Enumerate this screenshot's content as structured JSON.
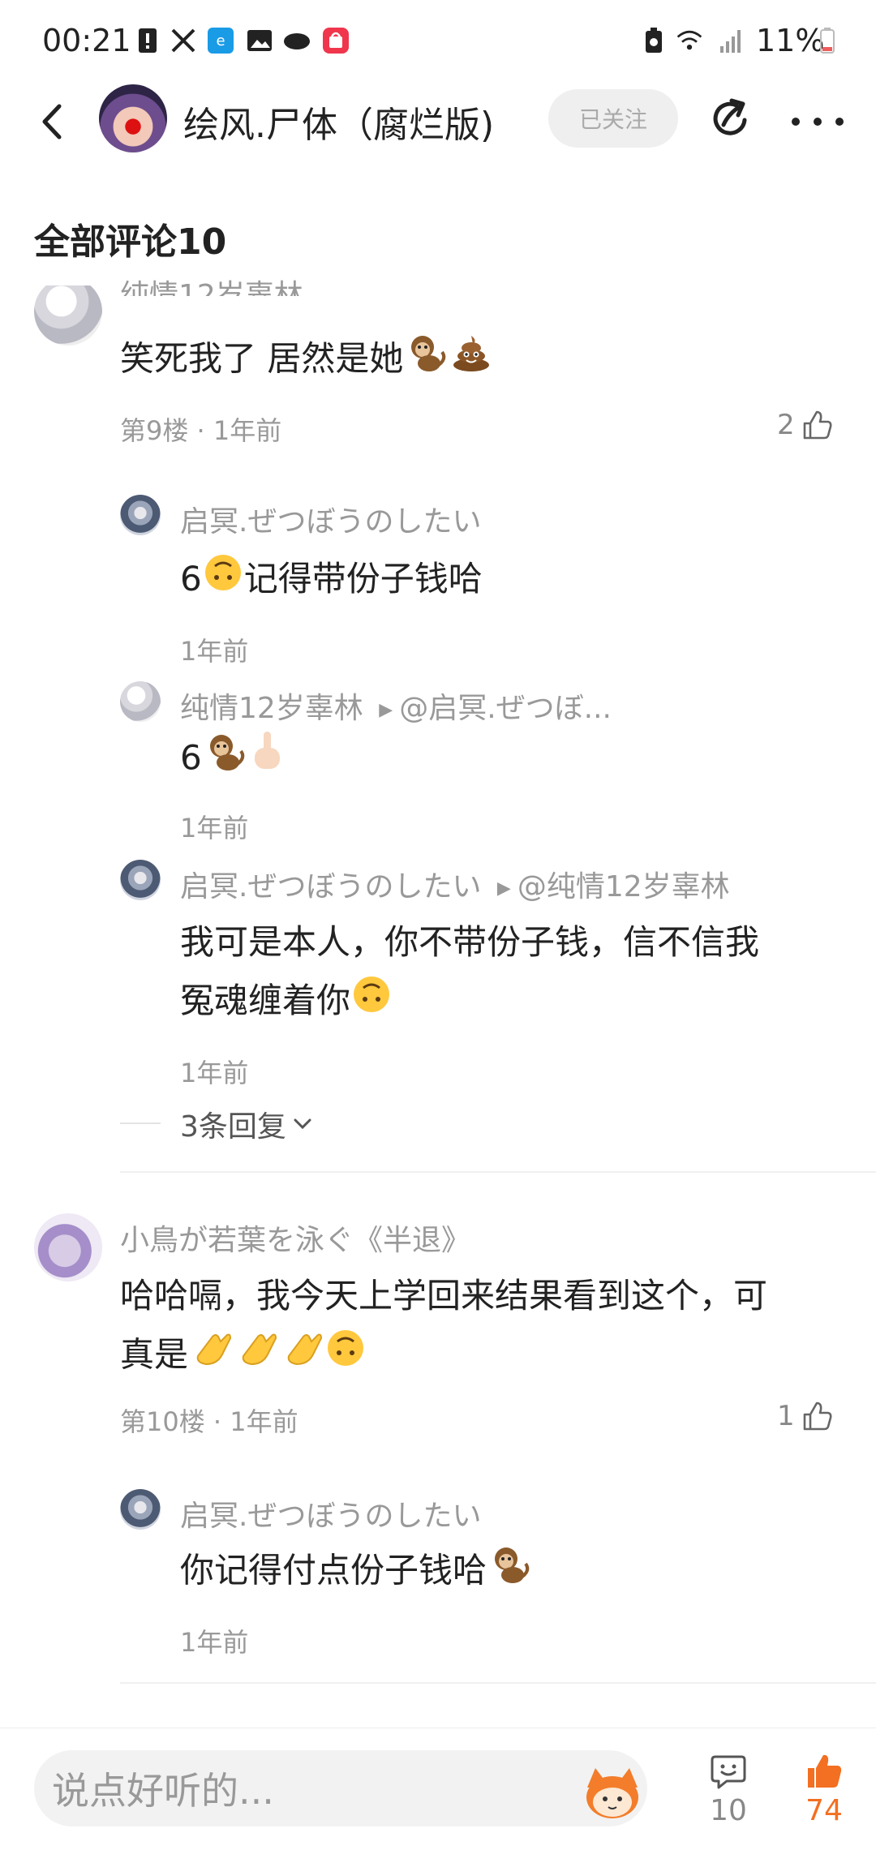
{
  "status_bar": {
    "time": "00:21",
    "battery": "11%"
  },
  "header": {
    "title": "绘风.尸体（腐烂版)",
    "follow_label": "已关注"
  },
  "section_title": "全部评论10",
  "comments": [
    {
      "author": "纯情12岁辜林",
      "content": "笑死我了 居然是她",
      "meta": "第9楼 · 1年前",
      "likes": "2",
      "replies": [
        {
          "author": "启冥.ぜつぼうのしたい",
          "content": "6",
          "content_after": "记得带份子钱哈",
          "time": "1年前"
        },
        {
          "author": "纯情12岁辜林",
          "reply_to": "@启冥.ぜつぼ...",
          "content": "6",
          "time": "1年前"
        },
        {
          "author": "启冥.ぜつぼうのしたい",
          "reply_to": "@纯情12岁辜林",
          "content_line1": "我可是本人，你不带份子钱，信不信我",
          "content_line2": "冤魂缠着你",
          "time": "1年前"
        }
      ],
      "more_replies": "3条回复"
    },
    {
      "author": "小鳥が若葉を泳ぐ《半退》",
      "content_line1": "哈哈嗝，我今天上学回来结果看到这个，可",
      "content_line2": "真是",
      "meta": "第10楼 · 1年前",
      "likes": "1",
      "replies": [
        {
          "author": "启冥.ぜつぼうのしたい",
          "content": "你记得付点份子钱哈",
          "time": "1年前"
        }
      ]
    }
  ],
  "bottom_bar": {
    "input_placeholder": "说点好听的...",
    "comment_count": "10",
    "like_count": "74"
  },
  "colors": {
    "accent": "#f36f21",
    "muted_text": "#999999",
    "follow_bg": "#efefef"
  }
}
